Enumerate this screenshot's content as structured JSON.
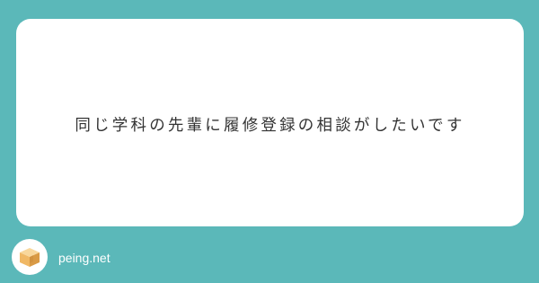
{
  "card": {
    "question": "同じ学科の先輩に履修登録の相談がしたいです"
  },
  "footer": {
    "brand": "peing.net",
    "logo_icon": "cardboard-box-icon"
  },
  "colors": {
    "background": "#5bb8b9",
    "card": "#ffffff",
    "text": "#333333",
    "box_light": "#f5c37a",
    "box_dark": "#d99a45"
  }
}
